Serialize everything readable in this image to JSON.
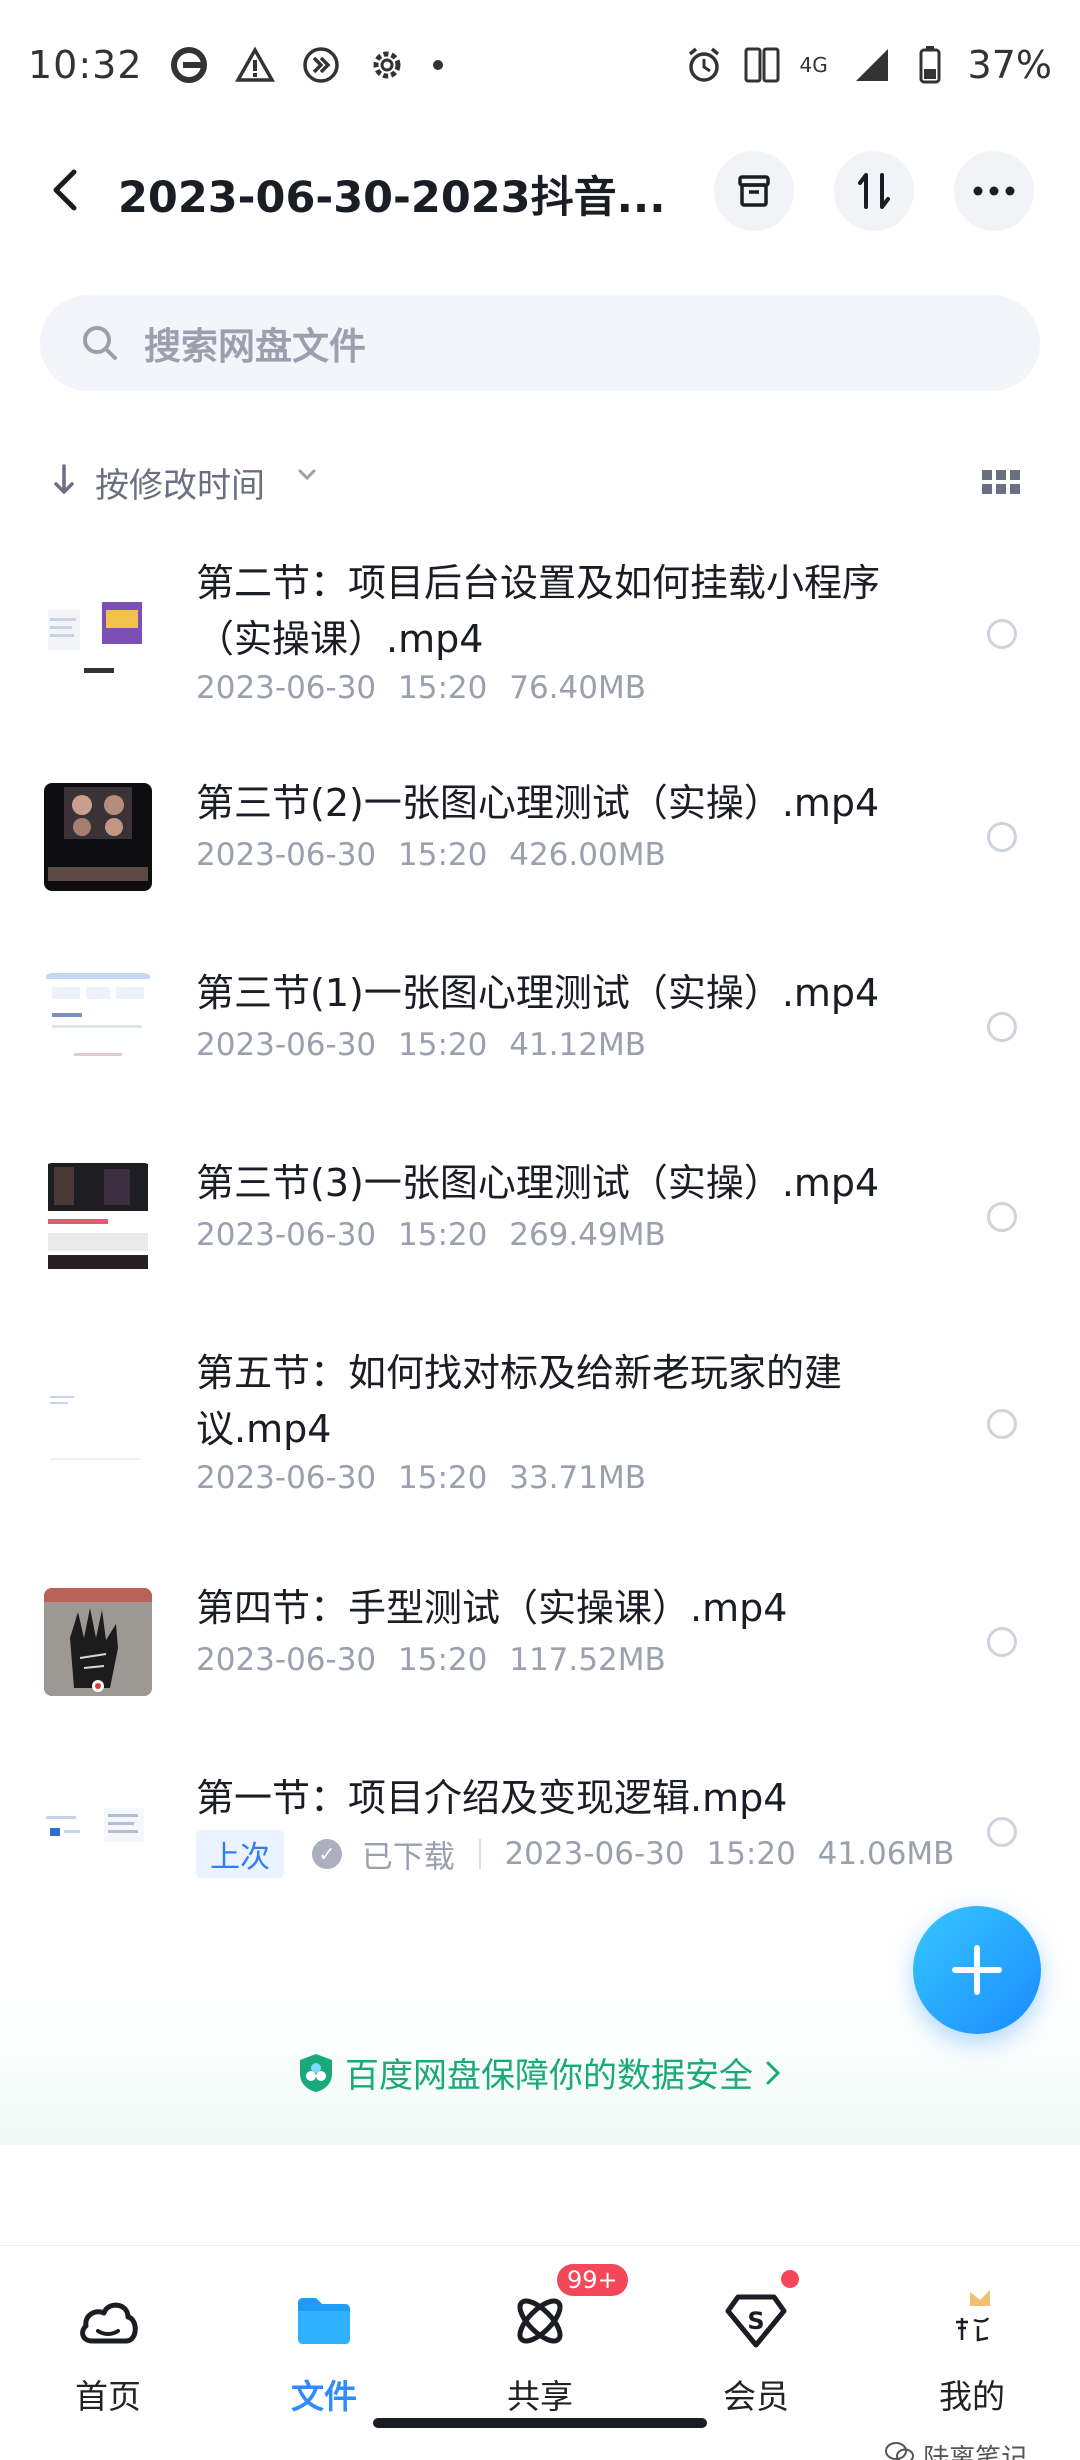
{
  "status_bar": {
    "time": "10:32",
    "network": "4G",
    "battery": "37%",
    "icons_left": [
      "browser-e-icon",
      "warning-icon",
      "forward-icon",
      "settings-icon",
      "dot-icon"
    ],
    "icons_right": [
      "alarm-icon",
      "dual-sim-icon",
      "signal-icon",
      "battery-icon"
    ]
  },
  "header": {
    "title": "2023-06-30-2023抖音...",
    "actions": [
      "back",
      "archive",
      "transfer",
      "more"
    ]
  },
  "search": {
    "placeholder": "搜索网盘文件"
  },
  "sort": {
    "label": "按修改时间"
  },
  "files": [
    {
      "name": "第二节：项目后台设置及如何挂载小程序（实操课）.mp4",
      "date": "2023-06-30",
      "time": "15:20",
      "size": "76.40MB",
      "thumb": "screen-light"
    },
    {
      "name": "第三节(2)一张图心理测试（实操）.mp4",
      "date": "2023-06-30",
      "time": "15:20",
      "size": "426.00MB",
      "thumb": "dark-faces"
    },
    {
      "name": "第三节(1)一张图心理测试（实操）.mp4",
      "date": "2023-06-30",
      "time": "15:20",
      "size": "41.12MB",
      "thumb": "screen-light"
    },
    {
      "name": "第三节(3)一张图心理测试（实操）.mp4",
      "date": "2023-06-30",
      "time": "15:20",
      "size": "269.49MB",
      "thumb": "mixed"
    },
    {
      "name": "第五节：如何找对标及给新老玩家的建议.mp4",
      "date": "2023-06-30",
      "time": "15:20",
      "size": "33.71MB",
      "thumb": "blank"
    },
    {
      "name": "第四节：手型测试（实操课）.mp4",
      "date": "2023-06-30",
      "time": "15:20",
      "size": "117.52MB",
      "thumb": "palm"
    },
    {
      "name": "第一节：项目介绍及变现逻辑.mp4",
      "date": "2023-06-30",
      "time": "15:20",
      "size": "41.06MB",
      "thumb": "screen-light",
      "tag": "上次",
      "downloaded": "已下载"
    }
  ],
  "security": {
    "text": "百度网盘保障你的数据安全"
  },
  "bottom_nav": [
    {
      "label": "首页",
      "icon": "cloud-home-icon"
    },
    {
      "label": "文件",
      "icon": "folder-icon",
      "active": true
    },
    {
      "label": "共享",
      "icon": "share-atom-icon",
      "badge": "99+"
    },
    {
      "label": "会员",
      "icon": "vip-diamond-icon"
    },
    {
      "label": "我的",
      "icon": "avatar-icon"
    }
  ],
  "watermark": "陆离笔记",
  "colors": {
    "accent": "#2f8cff",
    "secure": "#1aa97a",
    "badge": "#f5475a"
  }
}
